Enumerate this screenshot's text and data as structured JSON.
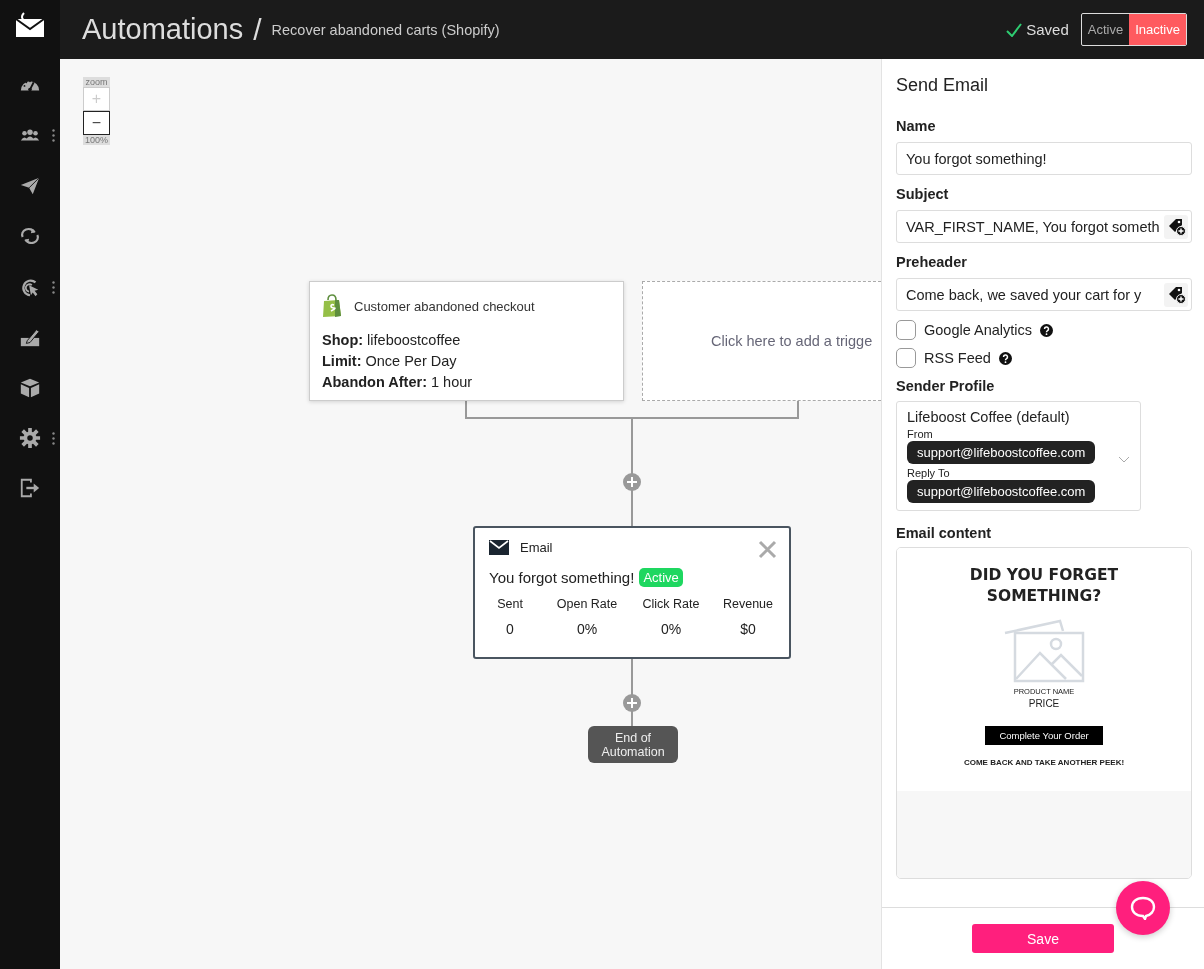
{
  "sidebar": {
    "nav_items": [
      {
        "kind": "dashboard",
        "more": false
      },
      {
        "kind": "contacts",
        "more": true
      },
      {
        "kind": "campaigns",
        "more": false
      },
      {
        "kind": "automations",
        "more": false
      },
      {
        "kind": "tracking",
        "more": true
      },
      {
        "kind": "forms",
        "more": false
      },
      {
        "kind": "products",
        "more": false
      },
      {
        "kind": "settings",
        "more": true
      },
      {
        "kind": "logout",
        "more": false
      }
    ]
  },
  "header": {
    "title": "Automations",
    "separator": "/",
    "subtitle": "Recover abandoned carts (Shopify)",
    "saved": "Saved",
    "status_options": [
      {
        "label": "Active",
        "selected": false
      },
      {
        "label": "Inactive",
        "selected": true
      }
    ]
  },
  "canvas": {
    "zoom": {
      "label": "zoom",
      "plus": "+",
      "minus": "−",
      "percent": "100%"
    },
    "trigger": {
      "title": "Customer abandoned checkout",
      "fields": [
        {
          "label": "Shop:",
          "value": "lifeboostcoffee"
        },
        {
          "label": "Limit:",
          "value": "Once Per Day"
        },
        {
          "label": "Abandon After:",
          "value": "1 hour"
        }
      ]
    },
    "add_trigger": {
      "text": "Click here to add a trigge"
    },
    "email_step": {
      "type_label": "Email",
      "name": "You forgot something!",
      "status": {
        "label": "Active",
        "active": true
      },
      "stats": [
        {
          "label": "Sent",
          "value": "0"
        },
        {
          "label": "Open Rate",
          "value": "0%"
        },
        {
          "label": "Click Rate",
          "value": "0%"
        },
        {
          "label": "Revenue",
          "value": "$0"
        }
      ]
    },
    "end": {
      "text": "End of Automation"
    }
  },
  "panel": {
    "title": "Send Email",
    "fields": [
      {
        "label": "Name",
        "value": "You forgot something!",
        "tag_button": false
      },
      {
        "label": "Subject",
        "value": "VAR_FIRST_NAME, You forgot someth",
        "tag_button": true
      },
      {
        "label": "Preheader",
        "value": "Come back, we saved your cart for y",
        "tag_button": true
      }
    ],
    "checkboxes": [
      {
        "label": "Google Analytics",
        "checked": false
      },
      {
        "label": "RSS Feed",
        "checked": false
      }
    ],
    "sender_profile": {
      "label": "Sender Profile",
      "name": "Lifeboost Coffee",
      "note": "(default)",
      "from_label": "From",
      "from": "support@lifeboostcoffee.com",
      "reply_to_label": "Reply To",
      "reply_to": "support@lifeboostcoffee.com"
    },
    "email_content": {
      "label": "Email content",
      "heading": "DID YOU FORGET SOMETHING?",
      "product_name": "PRODUCT NAME",
      "price": "PRICE",
      "button": "Complete Your Order",
      "footer": "COME BACK AND TAKE ANOTHER PEEK!"
    },
    "save": "Save"
  }
}
